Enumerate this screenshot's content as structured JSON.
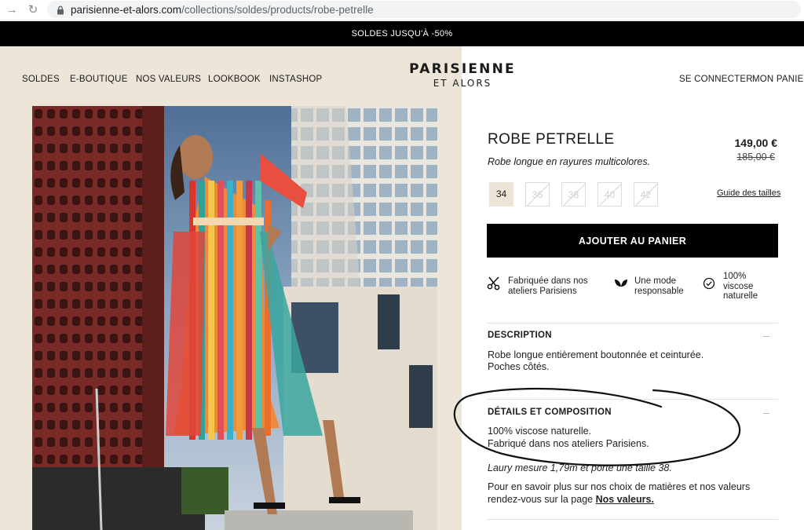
{
  "browser": {
    "url_domain": "parisienne-et-alors.com",
    "url_path": "/collections/soldes/products/robe-petrelle"
  },
  "promo": {
    "text": "SOLDES JUSQU'À -50%"
  },
  "nav": {
    "left": [
      "SOLDES",
      "E-BOUTIQUE",
      "NOS VALEURS",
      "LOOKBOOK",
      "INSTASHOP"
    ],
    "login": "SE CONNECTER",
    "cart": "MON PANIER"
  },
  "logo": {
    "main": "PARISIENNE",
    "sub": "ET ALORS"
  },
  "product": {
    "title": "ROBE PETRELLE",
    "subtitle": "Robe longue en rayures multicolores.",
    "price": "149,00 €",
    "old_price": "185,00 €",
    "sizes": [
      {
        "label": "34",
        "available": true,
        "selected": true
      },
      {
        "label": "36",
        "available": false,
        "selected": false
      },
      {
        "label": "38",
        "available": false,
        "selected": false
      },
      {
        "label": "40",
        "available": false,
        "selected": false
      },
      {
        "label": "42",
        "available": false,
        "selected": false
      }
    ],
    "size_guide": "Guide des tailles",
    "add_to_cart": "AJOUTER AU PANIER"
  },
  "features": [
    {
      "icon": "scissors-icon",
      "line1": "Fabriquée dans nos",
      "line2": "ateliers Parisiens",
      "line3": ""
    },
    {
      "icon": "leaf-icon",
      "line1": "Une mode",
      "line2": "responsable",
      "line3": ""
    },
    {
      "icon": "check-circle-icon",
      "line1": "100%",
      "line2": "viscose",
      "line3": "naturelle"
    }
  ],
  "description": {
    "heading": "DESCRIPTION",
    "line1": "Robe longue entièrement boutonnée et ceinturée.",
    "line2": "Poches côtés."
  },
  "details": {
    "heading": "DÉTAILS ET COMPOSITION",
    "line1": "100% viscose naturelle.",
    "line2": "Fabriqué dans nos ateliers Parisiens.",
    "model_note": "Laury mesure 1,79m et porte une taille 38.",
    "more_line1": "Pour en savoir plus sur nos choix de matières et nos valeurs",
    "more_line2": "rendez-vous sur la page ",
    "values_link": "Nos valeurs."
  },
  "colors": {
    "promo_bg": "#000000",
    "beige": "#ede5d8",
    "button_bg": "#000000",
    "annotation": "#111111"
  }
}
